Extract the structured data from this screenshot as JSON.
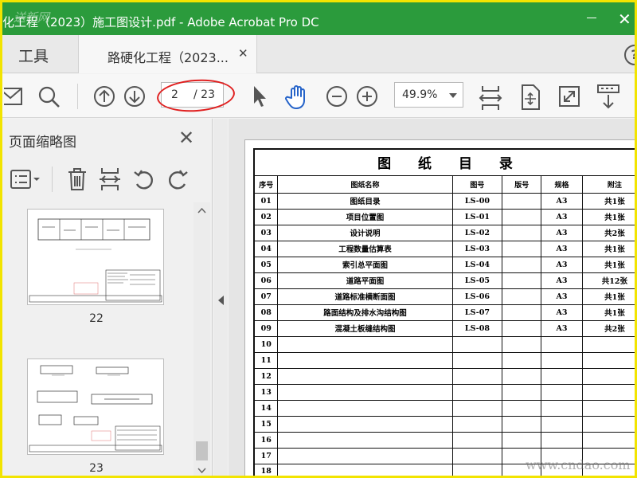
{
  "window": {
    "title": "化工程（2023）施工图设计.pdf - Adobe Acrobat Pro DC",
    "watermark_top": "送新网",
    "close_glyph": "✕"
  },
  "tabs": {
    "tools_label": "工具",
    "doc_label": "路硬化工程（2023...",
    "close_glyph": "✕",
    "help_glyph": "?"
  },
  "toolbar": {
    "current_page": "2",
    "total_pages": "/ 23",
    "zoom": "49.9%"
  },
  "panel": {
    "title": "页面缩略图",
    "close_glyph": "✕",
    "thumbnails": [
      {
        "page": "22"
      },
      {
        "page": "23"
      }
    ]
  },
  "document": {
    "table_title": "图 纸 目 录",
    "headers": [
      "序号",
      "图纸名称",
      "图号",
      "版号",
      "规格",
      "附注"
    ],
    "rows": [
      [
        "01",
        "图纸目录",
        "LS-00",
        "",
        "A3",
        "共1张"
      ],
      [
        "02",
        "项目位置图",
        "LS-01",
        "",
        "A3",
        "共1张"
      ],
      [
        "03",
        "设计说明",
        "LS-02",
        "",
        "A3",
        "共2张"
      ],
      [
        "04",
        "工程数量估算表",
        "LS-03",
        "",
        "A3",
        "共1张"
      ],
      [
        "05",
        "索引总平面图",
        "LS-04",
        "",
        "A3",
        "共1张"
      ],
      [
        "06",
        "道路平面图",
        "LS-05",
        "",
        "A3",
        "共12张"
      ],
      [
        "07",
        "道路标准横断面图",
        "LS-06",
        "",
        "A3",
        "共1张"
      ],
      [
        "08",
        "路面结构及排水沟结构图",
        "LS-07",
        "",
        "A3",
        "共1张"
      ],
      [
        "09",
        "混凝土板缝结构图",
        "LS-08",
        "",
        "A3",
        "共2张"
      ],
      [
        "10",
        "",
        "",
        "",
        "",
        ""
      ],
      [
        "11",
        "",
        "",
        "",
        "",
        ""
      ],
      [
        "12",
        "",
        "",
        "",
        "",
        ""
      ],
      [
        "13",
        "",
        "",
        "",
        "",
        ""
      ],
      [
        "14",
        "",
        "",
        "",
        "",
        ""
      ],
      [
        "15",
        "",
        "",
        "",
        "",
        ""
      ],
      [
        "16",
        "",
        "",
        "",
        "",
        ""
      ],
      [
        "17",
        "",
        "",
        "",
        "",
        ""
      ],
      [
        "18",
        "",
        "",
        "",
        "",
        ""
      ]
    ]
  },
  "watermark": "www.cndao.com",
  "colors": {
    "titlebar": "#2b9b3c",
    "highlight_ring": "#e02020",
    "frame": "#f2e400"
  }
}
